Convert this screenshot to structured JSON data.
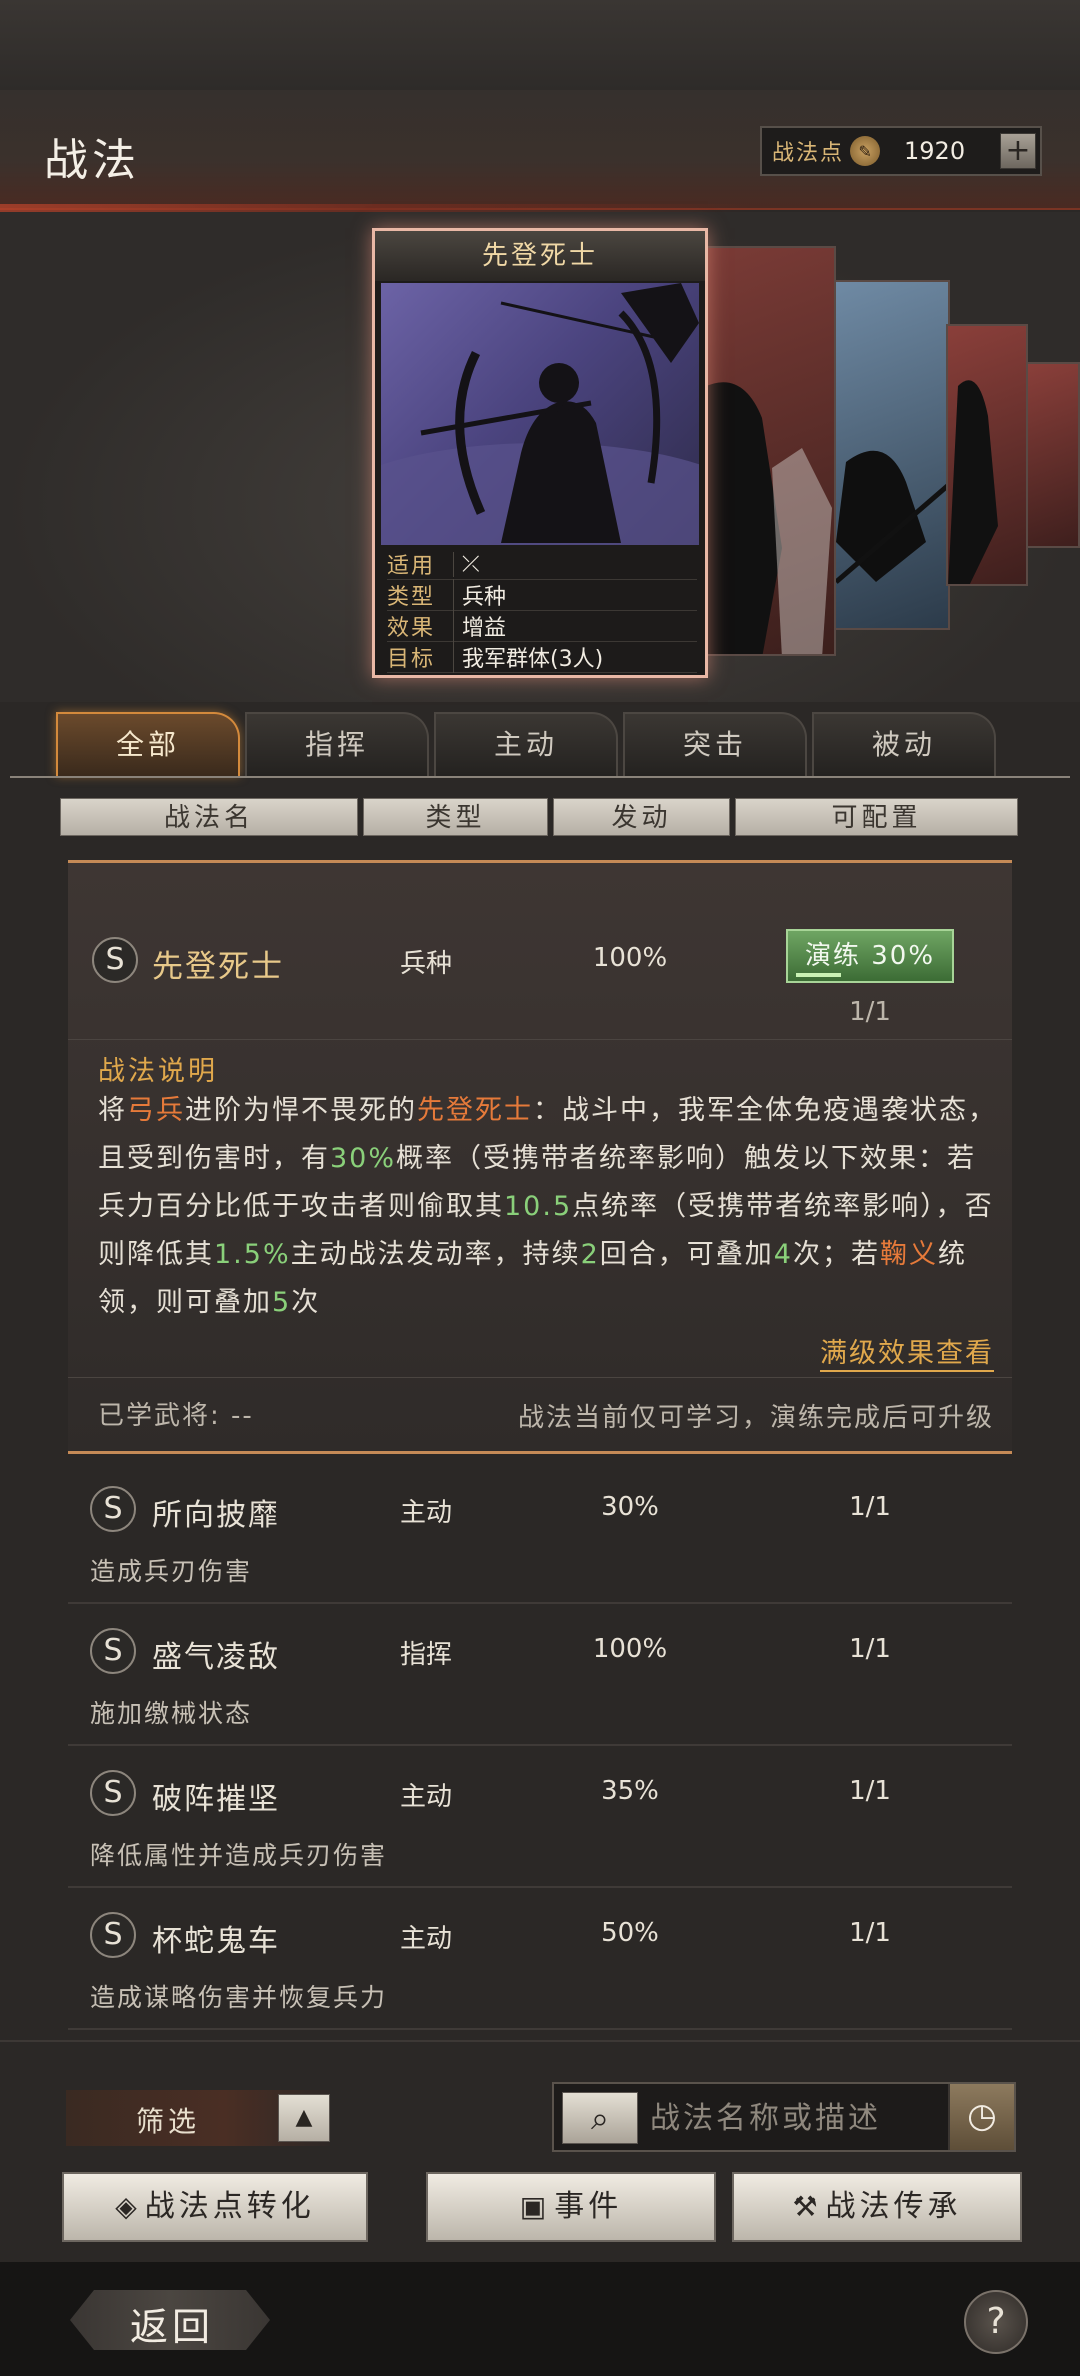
{
  "header": {
    "title": "战法",
    "points_label": "战法点",
    "points_value": "1920",
    "plus_label": "+"
  },
  "card": {
    "title": "先登死士",
    "rows": [
      {
        "key": "适用",
        "value": ""
      },
      {
        "key": "类型",
        "value": "兵种"
      },
      {
        "key": "效果",
        "value": "增益"
      },
      {
        "key": "目标",
        "value": "我军群体(3人)"
      }
    ]
  },
  "tabs": [
    {
      "label": "全部",
      "active": true
    },
    {
      "label": "指挥",
      "active": false
    },
    {
      "label": "主动",
      "active": false
    },
    {
      "label": "突击",
      "active": false
    },
    {
      "label": "被动",
      "active": false
    }
  ],
  "columns": [
    "战法名",
    "类型",
    "发动",
    "可配置"
  ],
  "expanded": {
    "badge": "S",
    "name": "先登死士",
    "type": "兵种",
    "rate": "100%",
    "train_label": "演练 30%",
    "train_progress": 0.3,
    "config": "1/1",
    "desc_title": "战法说明",
    "desc_parts": [
      {
        "t": "将",
        "c": ""
      },
      {
        "t": "弓兵",
        "c": "o"
      },
      {
        "t": "进阶为悍不畏死的",
        "c": ""
      },
      {
        "t": "先登死士",
        "c": "o"
      },
      {
        "t": "：战斗中，我军全体免疫遇袭状态，且受到伤害时，有",
        "c": ""
      },
      {
        "t": "30%",
        "c": "g"
      },
      {
        "t": "概率（受携带者统率影响）触发以下效果：若兵力百分比低于攻击者则偷取其",
        "c": ""
      },
      {
        "t": "10.5",
        "c": "g"
      },
      {
        "t": "点统率（受携带者统率影响），否则降低其",
        "c": ""
      },
      {
        "t": "1.5%",
        "c": "g"
      },
      {
        "t": "主动战法发动率，持续",
        "c": ""
      },
      {
        "t": "2",
        "c": "g"
      },
      {
        "t": "回合，可叠加",
        "c": ""
      },
      {
        "t": "4",
        "c": "g"
      },
      {
        "t": "次；若",
        "c": ""
      },
      {
        "t": "鞠义",
        "c": "o"
      },
      {
        "t": "统领，则可叠加",
        "c": ""
      },
      {
        "t": "5",
        "c": "g"
      },
      {
        "t": "次",
        "c": ""
      }
    ],
    "full_link": "满级效果查看",
    "learned": "已学武将: --",
    "learn_note": "战法当前仅可学习，演练完成后可升级"
  },
  "rows": [
    {
      "badge": "S",
      "name": "所向披靡",
      "type": "主动",
      "rate": "30%",
      "config": "1/1",
      "desc": "造成兵刃伤害"
    },
    {
      "badge": "S",
      "name": "盛气凌敌",
      "type": "指挥",
      "rate": "100%",
      "config": "1/1",
      "desc": "施加缴械状态"
    },
    {
      "badge": "S",
      "name": "破阵摧坚",
      "type": "主动",
      "rate": "35%",
      "config": "1/1",
      "desc": "降低属性并造成兵刃伤害"
    },
    {
      "badge": "S",
      "name": "杯蛇鬼车",
      "type": "主动",
      "rate": "50%",
      "config": "1/1",
      "desc": "造成谋略伤害并恢复兵力"
    }
  ],
  "controls": {
    "filter_label": "筛选",
    "filter_toggle": "▲",
    "search_placeholder": "战法名称或描述",
    "search_icon": "magnifier-icon",
    "clock_icon": "clock-icon",
    "btn_convert": "战法点转化",
    "btn_event": "事件",
    "btn_inherit": "战法传承"
  },
  "footer": {
    "back_label": "返回",
    "help_label": "?"
  }
}
